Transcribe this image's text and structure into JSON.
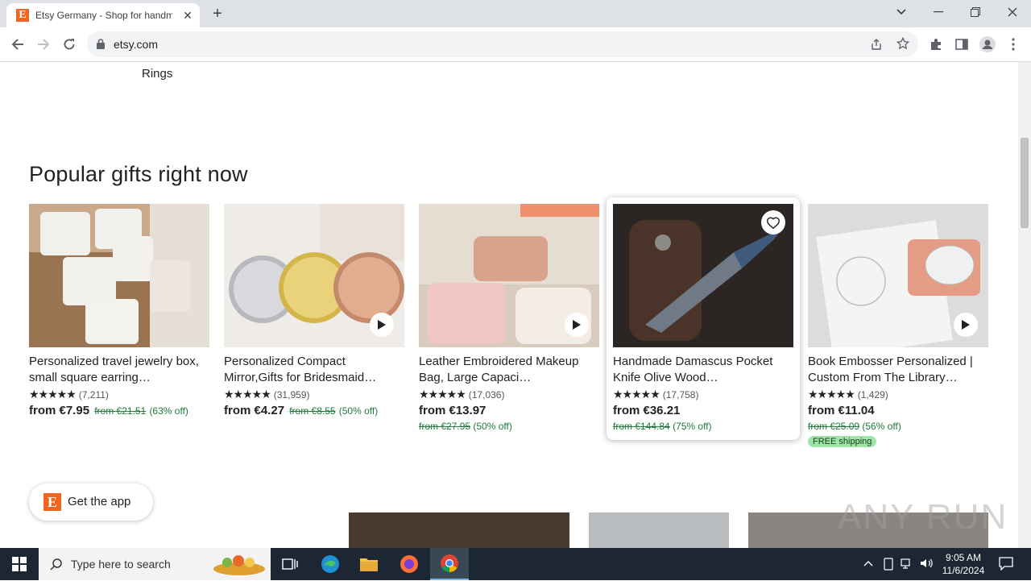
{
  "browser": {
    "tab_title": "Etsy Germany - Shop for handmade",
    "tab_favicon": "E",
    "new_tab_label": "+",
    "url": "etsy.com"
  },
  "page": {
    "prev_category_label": "Rings",
    "section_title": "Popular gifts right now",
    "products": [
      {
        "title": "Personalized travel jewelry box, small square earring…",
        "stars": "★★★★★",
        "reviews": "(7,211)",
        "price": "from €7.95",
        "original": "from €21.51",
        "discount": "(63% off)",
        "has_video": true
      },
      {
        "title": "Personalized Compact Mirror,Gifts for Bridesmaid…",
        "stars": "★★★★★",
        "reviews": "(31,959)",
        "price": "from €4.27",
        "original": "from €8.55",
        "discount": "(50% off)",
        "has_video": true
      },
      {
        "title": "Leather Embroidered Makeup Bag, Large Capaci…",
        "stars": "★★★★★",
        "reviews": "(17,036)",
        "price": "from €13.97",
        "original": "from €27.95",
        "discount": "(50% off)",
        "has_video": true
      },
      {
        "title": "Handmade Damascus Pocket Knife Olive Wood…",
        "stars": "★★★★★",
        "reviews": "(17,758)",
        "price": "from €36.21",
        "original": "from €144.84",
        "discount": "(75% off)",
        "has_video": false
      },
      {
        "title": "Book Embosser Personalized | Custom From The Library…",
        "stars": "★★★★★",
        "reviews": "(1,429)",
        "price": "from €11.04",
        "original": "from €25.09",
        "discount": "(56% off)",
        "badge": "FREE shipping",
        "has_video": true
      }
    ],
    "get_app_label": "Get the app",
    "watermark": "ANY RUN"
  },
  "taskbar": {
    "search_placeholder": "Type here to search",
    "time": "9:05 AM",
    "date": "11/6/2024"
  },
  "colors": {
    "etsy_orange": "#f1641e",
    "discount_green": "#1f7a3c",
    "free_ship_bg": "#9ee6a8",
    "taskbar": "#1c2733"
  }
}
